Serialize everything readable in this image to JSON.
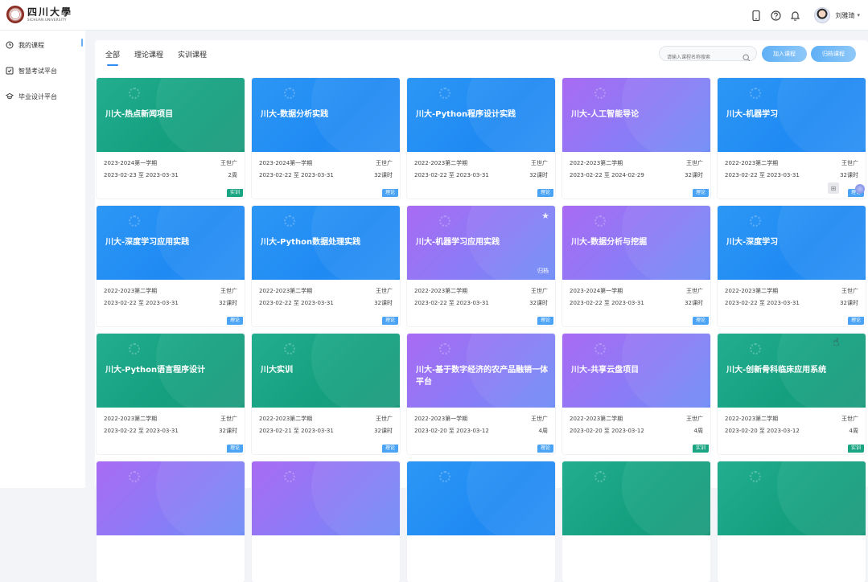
{
  "header": {
    "logo_cn": "四川大學",
    "logo_en": "SICHUAN UNIVERSITY",
    "user_name": "刘雅琦",
    "icons": [
      "mobile-icon",
      "help-icon",
      "bell-icon"
    ]
  },
  "sidebar": {
    "items": [
      {
        "label": "我的课程",
        "icon": "clock-icon"
      },
      {
        "label": "智慧考试平台",
        "icon": "exam-icon"
      },
      {
        "label": "毕业设计平台",
        "icon": "graduation-cap-icon"
      }
    ]
  },
  "main": {
    "tabs": [
      "全部",
      "理论课程",
      "实训课程"
    ],
    "search_placeholder": "请输入课程名称搜索",
    "btn_join": "加入课程",
    "btn_archive": "归档课程"
  },
  "cards": [
    {
      "title": "川大-热点新闻项目",
      "color": "teal",
      "term": "2023-2024第一学期",
      "teacher": "王世广",
      "dates": "2023-02-23 至 2023-03-31",
      "hours": "2周",
      "tag": "实训",
      "tag_color": "green"
    },
    {
      "title": "川大-数据分析实践",
      "color": "blue",
      "term": "2023-2024第一学期",
      "teacher": "王世广",
      "dates": "2023-02-22 至 2023-03-31",
      "hours": "32课时",
      "tag": "理论",
      "tag_color": "blue"
    },
    {
      "title": "川大-Python程序设计实践",
      "color": "blue",
      "term": "2022-2023第二学期",
      "teacher": "王世广",
      "dates": "2023-02-22 至 2023-03-31",
      "hours": "32课时",
      "tag": "理论",
      "tag_color": "blue"
    },
    {
      "title": "川大-人工智能导论",
      "color": "purple",
      "term": "2022-2023第二学期",
      "teacher": "王世广",
      "dates": "2023-02-22 至 2024-02-29",
      "hours": "32课时",
      "tag": "理论",
      "tag_color": "blue"
    },
    {
      "title": "川大-机器学习",
      "color": "blue",
      "term": "2022-2023第二学期",
      "teacher": "王世广",
      "dates": "2023-02-22 至 2023-03-31",
      "hours": "32课时",
      "tag": "理论",
      "tag_color": "blue"
    },
    {
      "title": "川大-深度学习应用实践",
      "color": "blue",
      "term": "2022-2023第二学期",
      "teacher": "王世广",
      "dates": "2023-02-22 至 2023-03-31",
      "hours": "32课时",
      "tag": "理论",
      "tag_color": "blue"
    },
    {
      "title": "川大-Python数据处理实践",
      "color": "blue",
      "term": "2022-2023第二学期",
      "teacher": "王世广",
      "dates": "2023-02-22 至 2023-03-31",
      "hours": "32课时",
      "tag": "理论",
      "tag_color": "blue"
    },
    {
      "title": "川大-机器学习应用实践",
      "color": "purple",
      "term": "2022-2023第二学期",
      "teacher": "王世广",
      "dates": "2023-02-22 至 2023-03-31",
      "hours": "32课时",
      "tag": "理论",
      "tag_color": "blue",
      "starred": true,
      "archived": "归档"
    },
    {
      "title": "川大-数据分析与挖掘",
      "color": "purple",
      "term": "2023-2024第一学期",
      "teacher": "王世广",
      "dates": "2023-02-22 至 2023-03-31",
      "hours": "32课时",
      "tag": "理论",
      "tag_color": "blue"
    },
    {
      "title": "川大-深度学习",
      "color": "blue",
      "term": "2022-2023第二学期",
      "teacher": "王世广",
      "dates": "2023-02-22 至 2023-03-31",
      "hours": "32课时",
      "tag": "理论",
      "tag_color": "blue"
    },
    {
      "title": "川大-Python语言程序设计",
      "color": "teal",
      "term": "2022-2023第二学期",
      "teacher": "王世广",
      "dates": "2023-02-22 至 2023-03-31",
      "hours": "32课时",
      "tag": "理论",
      "tag_color": "blue"
    },
    {
      "title": "川大实训",
      "color": "teal",
      "term": "2022-2023第二学期",
      "teacher": "王世广",
      "dates": "2023-02-21 至 2023-03-31",
      "hours": "32课时",
      "tag": "理论",
      "tag_color": "blue"
    },
    {
      "title": "川大-基于数字经济的农产品融销一体平台",
      "color": "purple",
      "term": "2022-2023第一学期",
      "teacher": "王世广",
      "dates": "2023-02-20 至 2023-03-12",
      "hours": "4周",
      "tag": "理论",
      "tag_color": "blue"
    },
    {
      "title": "川大-共享云盘项目",
      "color": "purple",
      "term": "2022-2023第二学期",
      "teacher": "王世广",
      "dates": "2023-02-20 至 2023-03-12",
      "hours": "4周",
      "tag": "实训",
      "tag_color": "green"
    },
    {
      "title": "川大-创新骨科临床应用系统",
      "color": "teal",
      "term": "2022-2023第二学期",
      "teacher": "王世广",
      "dates": "2023-02-20 至 2023-03-12",
      "hours": "4周",
      "tag": "实训",
      "tag_color": "green"
    },
    {
      "title": "",
      "color": "purple"
    },
    {
      "title": "",
      "color": "purple"
    },
    {
      "title": "",
      "color": "blue"
    },
    {
      "title": "",
      "color": "teal"
    },
    {
      "title": "",
      "color": "teal"
    }
  ],
  "colors": {
    "accent": "#2f8cf5",
    "teal": "#14a07f",
    "blue": "#1f8af3",
    "purple": "#8a7cf6"
  }
}
